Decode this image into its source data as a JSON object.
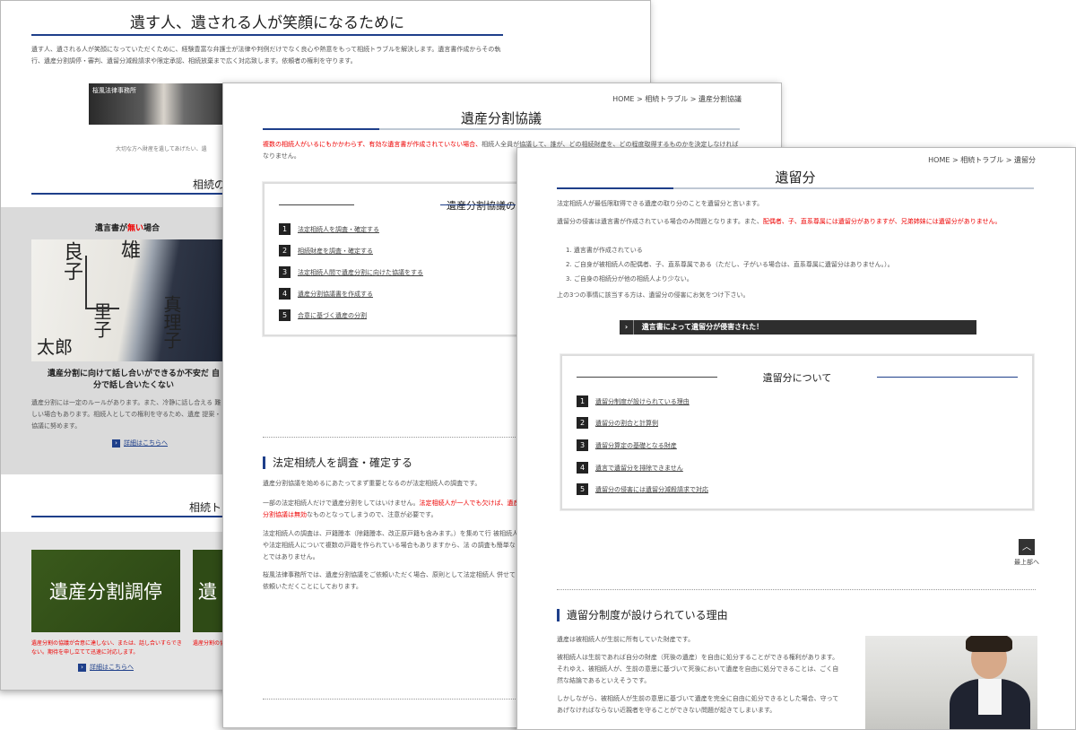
{
  "page1": {
    "title": "遺す人、遺される人が笑顔になるために",
    "intro": "遺す人、遺される人が笑顔になっていただくために、経験豊富な弁護士が法律や判例だけでなく良心や熱意をもって相続トラブルを解決します。遺言書作成からその執行、遺産分割調停・審判、遺留分減殺請求や限定承認、相続放棄まで広く対応致します。依頼者の権利を守ります。",
    "banner_label": "桜風法律事務所",
    "banner_caption": "大切な方へ財産を遺してあげたい、遺",
    "section1_title": "相続の",
    "card_heading_pre": "遺言書が",
    "card_heading_red": "無い",
    "card_heading_post": "場合",
    "photo_text": [
      "良子",
      "雄",
      "真理子",
      "里子",
      "太郎"
    ],
    "card_question": "遺産分割に向けて話し合いができるか不安だ 自分で話し合いたくない",
    "card_body": "遺産分割には一定のルールがあります。また、冷静に話し合える 難しい場合もあります。相続人としての権利を守るため、遺産 提案・協議に努めます。",
    "card_more": "詳細はこちらへ",
    "section2_title": "相続ト",
    "tile1_text": "遺産分割調停",
    "tile2_text": "遺",
    "tile_note": "遺産分割の協議が合意に達しない、または、話し合いすらできない。期待を申し立てて迅速に対応します。",
    "tile_note2": "遺産分割の協議",
    "tile_more": "詳細はこちらへ"
  },
  "page2": {
    "breadcrumb": "HOME > 相続トラブル > 遺産分割協議",
    "title": "遺産分割協議",
    "lead_red": "複数の相続人がいるにもかかわらず、有効な遺言書が作成されていない場合、",
    "lead": "相続人全員が協議して、誰が、どの相続財産を、どの程度取得するものかを決定しなければなりません。",
    "toc_title": "遺産分割協議の",
    "toc": [
      {
        "num": "1",
        "label": "法定相続人を調査・確定する"
      },
      {
        "num": "2",
        "label": "相続財産を調査・確定する"
      },
      {
        "num": "3",
        "label": "法定相続人間で遺産分割に向けた協議をする"
      },
      {
        "num": "4",
        "label": "遺産分割協議書を作成する"
      },
      {
        "num": "5",
        "label": "合意に基づく遺産の分割"
      }
    ],
    "section_title": "法定相続人を調査・確定する",
    "p1": "遺産分割協議を始めるにあたってまず重要となるのが法定相続人の調査です。",
    "p2_a": "一部の法定相続人だけで遺産分割をしてはいけません。",
    "p2_red": "法定相続人が一人でも欠け",
    "p2_b": "ば、遺産分割協議は無効",
    "p2_c": "なものとなってしまうので、注意が必要です。",
    "p3": "法定相続人の調査は、戸籍謄本（除籍謄本、改正原戸籍も含みます。）を集めて行 被相続人や法定相続人について複数の戸籍を作られている場合もありますから、法 の調査も簡単なことではありません。",
    "p4": "桜風法律事務所では、遺産分割協議をご依頼いただく場合、原則として法定相続人 併せてご依頼いただくことにしております。"
  },
  "page3": {
    "breadcrumb": "HOME > 相続トラブル > 遺留分",
    "title": "遺留分",
    "p1": "法定相続人が最低限取得できる遺産の取り分のことを遺留分と言います。",
    "p2_a": "遺留分の侵害は遺言書が作成されている場合のみ問題となります。また、",
    "p2_red": "配偶者、子、直系尊属には遺留分がありますが、兄弟姉妹には遺留分がありません。",
    "list": [
      "1. 遺言書が作成されている",
      "2. ご自身が被相続人の配偶者、子、直系尊属である（ただし、子がいる場合は、直系尊属に遺留分はありません。）。",
      "3. ご自身の相続分が他の相続人より少ない。"
    ],
    "p3": "上の3つの事情に該当する方は、遺留分の侵害にお気をつけ下さい。",
    "banner": "遺言書によって遺留分が侵害された！",
    "toc_title": "遺留分について",
    "toc": [
      {
        "num": "1",
        "label": "遺留分制度が設けられている理由"
      },
      {
        "num": "2",
        "label": "遺留分の割合と計算例"
      },
      {
        "num": "3",
        "label": "遺留分算定の基礎となる財産"
      },
      {
        "num": "4",
        "label": "遺言で遺留分を排除できません"
      },
      {
        "num": "5",
        "label": "遺留分の侵害には遺留分減殺請求で対応"
      }
    ],
    "top_label": "最上部へ",
    "section_title": "遺留分制度が設けられている理由",
    "sp1": "遺産は被相続人が生前に所有していた財産です。",
    "sp2": "被相続人は生前であれば自分の財産（死後の遺産）を自由に処分することができる権利があります。それゆえ、被相続人が、生前の意思に基づいて死後において遺産を自由に処分できることは、ごく自然な結論であるといえそうです。",
    "sp3": "しかしながら、被相続人が生前の意思に基づいて遺産を完全に自由に処分できるとした場合、守ってあげなければならない近親者を守ることができない問題が起きてしまいます。"
  }
}
